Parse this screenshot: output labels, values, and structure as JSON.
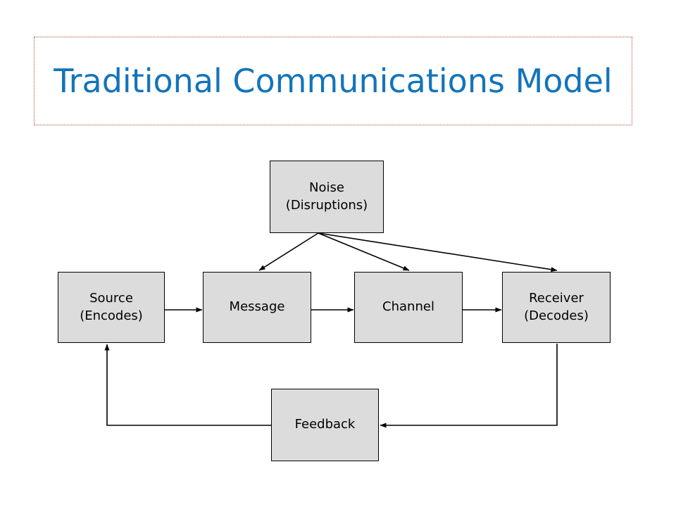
{
  "slide": {
    "title": "Traditional Communications Model",
    "title_color": "#1374BA",
    "title_border_color": "#B34B3F",
    "background_color": "#FFFFFF"
  },
  "diagram": {
    "type": "flowchart",
    "node_fill_color": "#DCDCDC",
    "node_border_color": "#000000",
    "connector_color": "#000000",
    "nodes": [
      {
        "id": "noise",
        "line1": "Noise",
        "line2": "(Disruptions)"
      },
      {
        "id": "source",
        "line1": "Source",
        "line2": "(Encodes)"
      },
      {
        "id": "message",
        "line1": "Message",
        "line2": ""
      },
      {
        "id": "channel",
        "line1": "Channel",
        "line2": ""
      },
      {
        "id": "receiver",
        "line1": "Receiver",
        "line2": "(Decodes)"
      },
      {
        "id": "feedback",
        "line1": "Feedback",
        "line2": ""
      }
    ],
    "edges": [
      {
        "from": "source",
        "to": "message",
        "style": "straight-arrow"
      },
      {
        "from": "message",
        "to": "channel",
        "style": "straight-arrow"
      },
      {
        "from": "channel",
        "to": "receiver",
        "style": "straight-arrow"
      },
      {
        "from": "noise",
        "to": "message",
        "style": "diagonal-arrow"
      },
      {
        "from": "noise",
        "to": "channel",
        "style": "diagonal-arrow"
      },
      {
        "from": "noise",
        "to": "receiver",
        "style": "diagonal-arrow"
      },
      {
        "from": "receiver",
        "to": "feedback",
        "style": "elbow-arrow"
      },
      {
        "from": "feedback",
        "to": "source",
        "style": "elbow-arrow"
      }
    ]
  }
}
